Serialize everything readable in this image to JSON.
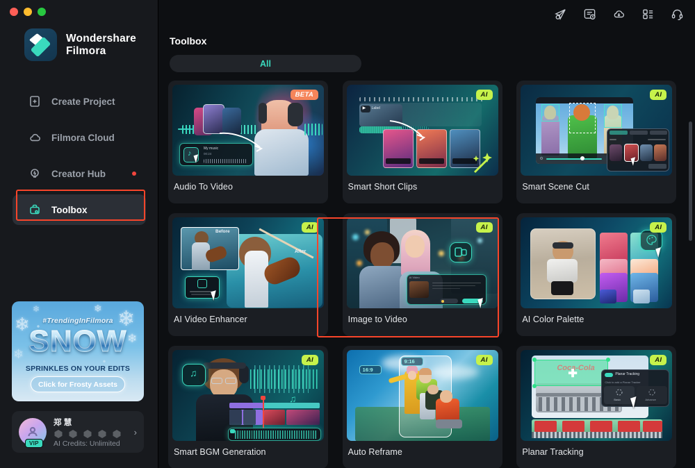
{
  "window": {
    "traffic_lights": [
      "close",
      "minimize",
      "zoom"
    ]
  },
  "sidebar": {
    "brand": {
      "line1": "Wondershare",
      "line2": "Filmora",
      "logo_name": "filmora-logo"
    },
    "items": [
      {
        "label": "Create Project",
        "icon": "file-plus-icon",
        "active": false,
        "dot": false
      },
      {
        "label": "Filmora Cloud",
        "icon": "cloud-icon",
        "active": false,
        "dot": false
      },
      {
        "label": "Creator Hub",
        "icon": "lightbulb-icon",
        "active": false,
        "dot": true
      },
      {
        "label": "Toolbox",
        "icon": "toolbox-icon",
        "active": true,
        "dot": false
      }
    ],
    "promo": {
      "tag": "#TrendingInFilmora",
      "title": "SNOW",
      "subtitle": "SPRINKLES ON YOUR EDITS",
      "button": "Click for Frosty Assets"
    },
    "user": {
      "name": "郑 慧",
      "vip": "VIP",
      "credits": "AI Credits: Unlimited",
      "chevron": "›",
      "badge_count": 5
    }
  },
  "topbar": {
    "icons": [
      {
        "name": "send-feedback-icon"
      },
      {
        "name": "task-history-icon"
      },
      {
        "name": "cloud-download-icon"
      },
      {
        "name": "apps-grid-icon"
      },
      {
        "name": "support-headset-icon"
      }
    ]
  },
  "main": {
    "page_title": "Toolbox",
    "filters": [
      {
        "label": "All",
        "selected": true
      }
    ],
    "cards": [
      {
        "title": "Audio To Video",
        "badge": "BETA",
        "badge_type": "beta",
        "selected": false
      },
      {
        "title": "Smart Short Clips",
        "badge": "AI",
        "badge_type": "ai",
        "selected": false
      },
      {
        "title": "Smart Scene Cut",
        "badge": "AI",
        "badge_type": "ai",
        "selected": false
      },
      {
        "title": "AI Video Enhancer",
        "badge": "AI",
        "badge_type": "ai",
        "selected": false
      },
      {
        "title": "Image to Video",
        "badge": "AI",
        "badge_type": "ai",
        "selected": true
      },
      {
        "title": "AI Color Palette",
        "badge": "AI",
        "badge_type": "ai",
        "selected": false
      },
      {
        "title": "Smart BGM Generation",
        "badge": "AI",
        "badge_type": "ai",
        "selected": false
      },
      {
        "title": "Auto Reframe",
        "badge": "AI",
        "badge_type": "ai",
        "selected": false
      },
      {
        "title": "Planar Tracking",
        "badge": "AI",
        "badge_type": "ai",
        "selected": false
      }
    ],
    "thumb_labels": {
      "audio_to_video_track": "My music",
      "audio_to_video_time": "00:24",
      "smart_short_clips_label": "Label",
      "auto_reframe_ratio_a": "16:9",
      "auto_reframe_ratio_b": "9:16",
      "ai_video_enhancer_before": "Before",
      "ai_video_enhancer_after": "After",
      "planar_tracking_panel": "Planar Tracking",
      "planar_tracking_hint": "Click to add a Planar Tracker",
      "planar_tracking_btn_a": "Basic",
      "planar_tracking_btn_b": "Advance"
    }
  },
  "colors": {
    "accent": "#3ad9bd",
    "badge_ai": "#c6f24b",
    "badge_beta": "#f5855a",
    "highlight": "#f8452a",
    "sidebar_bg": "#17191d",
    "main_bg": "#0d0f12",
    "card_bg": "#1b1e23"
  }
}
